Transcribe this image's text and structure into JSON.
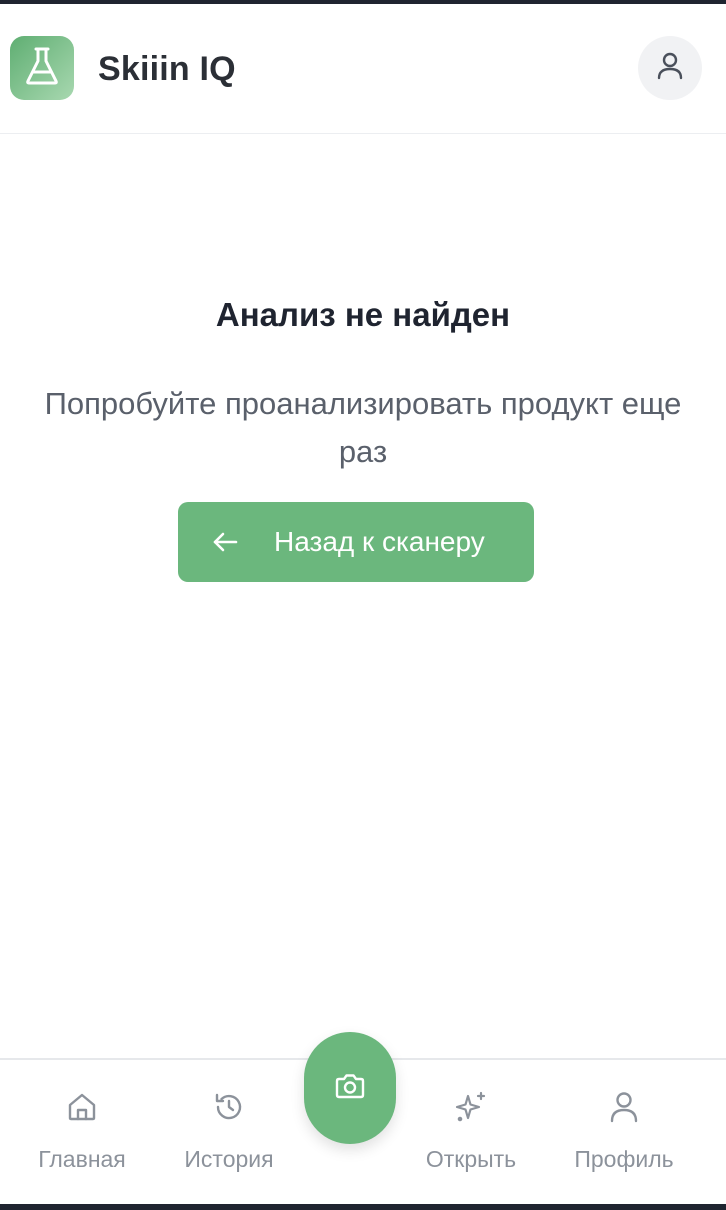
{
  "header": {
    "app_title": "Skiiin IQ",
    "logo_icon": "flask-icon",
    "profile_icon": "user-icon"
  },
  "main": {
    "title": "Анализ не найден",
    "subtitle_line1": "Попробуйте проанализировать продукт еще",
    "subtitle_line2": "раз",
    "back_button": {
      "label": "Назад к сканеру",
      "icon": "arrow-left-icon"
    }
  },
  "bottom_nav": {
    "items": [
      {
        "label": "Главная",
        "icon": "home-icon"
      },
      {
        "label": "История",
        "icon": "history-icon"
      },
      {
        "label": "Открыть",
        "icon": "sparkles-icon"
      },
      {
        "label": "Профиль",
        "icon": "user-icon"
      }
    ],
    "camera_icon": "camera-icon"
  },
  "colors": {
    "accent": "#6bb77d",
    "text_primary": "#1f2430",
    "text_secondary": "#5a606b",
    "nav_inactive": "#8c929b"
  }
}
